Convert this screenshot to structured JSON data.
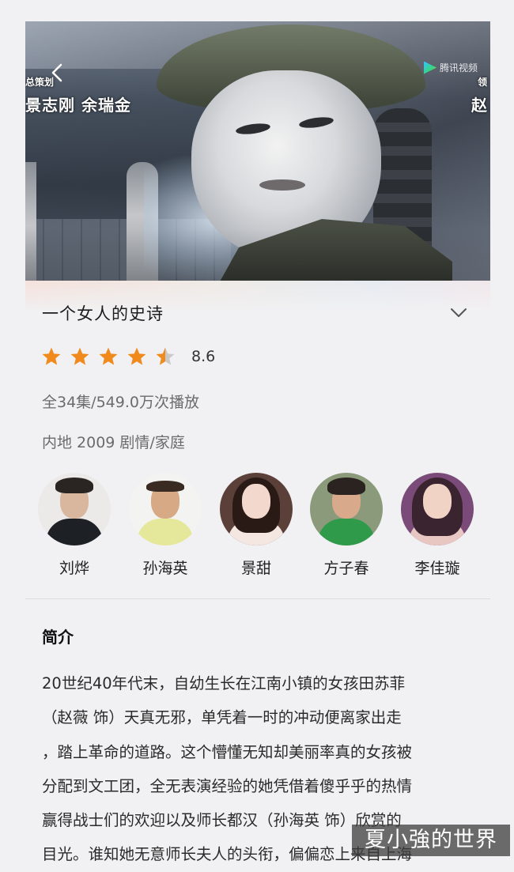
{
  "hero": {
    "credit_small": "总策划",
    "credit_names": "景志刚  余瑞金",
    "credit_right_small": "领",
    "credit_right": "赵",
    "watermark_logo": "腾讯视频",
    "icons": {
      "back": "back-arrow-icon",
      "logo": "tencent-video-logo-icon"
    }
  },
  "show": {
    "title": "一个女人的史诗",
    "rating": 8.6,
    "rating_text": "8.6",
    "stars": {
      "full": 4,
      "half": 1,
      "empty": 0
    },
    "episodes_plays": "全34集/549.0万次播放",
    "tags": "内地 2009 剧情/家庭"
  },
  "cast": [
    {
      "name": "刘烨"
    },
    {
      "name": "孙海英"
    },
    {
      "name": "景甜"
    },
    {
      "name": "方子春"
    },
    {
      "name": "李佳璇"
    }
  ],
  "synopsis": {
    "heading": "简介",
    "lines": [
      "20世纪40年代末，自幼生长在江南小镇的女孩田苏菲",
      "（赵薇 饰）天真无邪，单凭着一时的冲动便离家出走",
      "，踏上革命的道路。这个懵懂无知却美丽率真的女孩被",
      "分配到文工团，全无表演经验的她凭借着傻乎乎的热情",
      "赢得战士们的欢迎以及师长都汉（孙海英 饰）欣赏的",
      "目光。谁知她无意师长夫人的头衔，偏偏恋上来自上海"
    ]
  },
  "overlay_watermark": "夏小強的世界",
  "colors": {
    "star": "#f08a1c",
    "star_empty": "#c9c9c9",
    "background": "#f1f1f3"
  }
}
